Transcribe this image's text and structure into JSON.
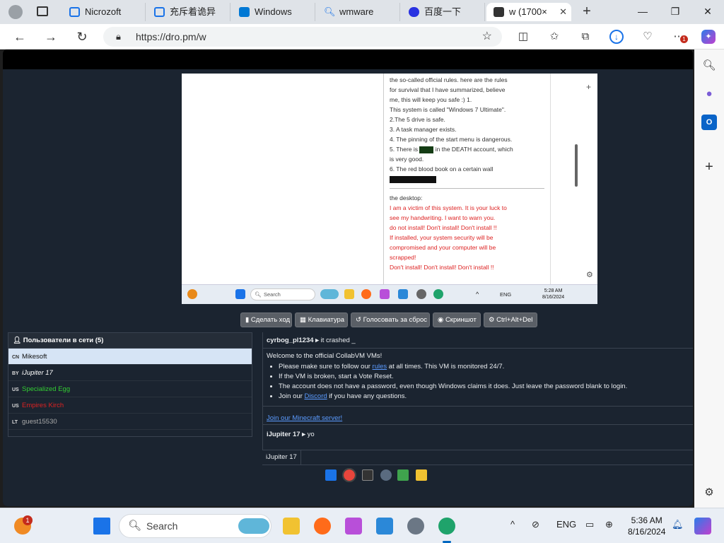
{
  "browser": {
    "tabs": [
      {
        "label": "Nicrozoft"
      },
      {
        "label": "充斥着诡异"
      },
      {
        "label": "Windows"
      },
      {
        "label": "wmware"
      },
      {
        "label": "百度一下"
      },
      {
        "label": "w (1700×"
      }
    ],
    "url": "https://dro.pm/w",
    "notification_count": "1"
  },
  "vm": {
    "doc_lines": [
      "the so-called official rules. here are the rules",
      "for survival that I have summarized, believe",
      "me, this will keep you safe :) 1.",
      "This system is called \"Windows 7 Ultimate\".",
      "2.The 5 drive is safe.",
      "3. A task manager exists.",
      "4. The pinning of the start menu is dangerous."
    ],
    "line5_a": "5. There is",
    "line5_b": "in the DEATH account, which",
    "line5_c": "is very good.",
    "line6": "6. The red blood book on a certain wall",
    "desktop_label": "the desktop:",
    "red_lines": [
      "I am a victim of this system. It is your luck to",
      "see my handwriting. I want to warn you.",
      "do not install! Don't install! Don't install !!",
      "If installed, your system security will be",
      "compromised and your computer will be",
      "scrapped!",
      "Don't install! Don't install! Don't install !!"
    ],
    "taskbar_search": "Search",
    "lang": "ENG",
    "time": "5:28 AM",
    "date": "8/16/2024"
  },
  "controls": {
    "take_turn": "Сделать ход",
    "keyboard": "Клавиатура",
    "vote_reset": "Голосовать за сброс",
    "screenshot": "Скриншот",
    "cad": "Ctrl+Alt+Del"
  },
  "users": {
    "header": "Пользователи в сети (5)",
    "list": [
      {
        "cc": "CN",
        "name": "Mikesoft",
        "color": "#111111"
      },
      {
        "cc": "BY",
        "name": "iJupiter 17",
        "color": "#ffffff"
      },
      {
        "cc": "US",
        "name": "Specialized Egg",
        "color": "#33cc33"
      },
      {
        "cc": "US",
        "name": "Empires Kirch",
        "color": "#dd2222"
      },
      {
        "cc": "LT",
        "name": "guest15530",
        "color": "#aaaaaa"
      }
    ]
  },
  "chat": {
    "msg1_user": "cyrbog_pl1234 ▸",
    "msg1_text": "it crashed _",
    "welcome": "Welcome to the official CollabVM VMs!",
    "b1_pre": "Please make sure to follow our",
    "b1_link": "rules",
    "b1_post": "at all times. This VM is monitored 24/7.",
    "b2": "If the VM is broken, start a Vote Reset.",
    "b3": "The account does not have a password, even though Windows claims it does. Just leave the password blank to login.",
    "b4_pre": "Join our",
    "b4_link": "Discord",
    "b4_post": "if you have any questions.",
    "minecraft": "Join our Minecraft server!",
    "msg2_user": "iJupiter 17 ▸",
    "msg2_text": "yo",
    "input_name": "iJupiter 17"
  },
  "windows": {
    "search": "Search",
    "lang": "ENG",
    "time": "5:36 AM",
    "date": "8/16/2024",
    "notification_count": "1"
  }
}
